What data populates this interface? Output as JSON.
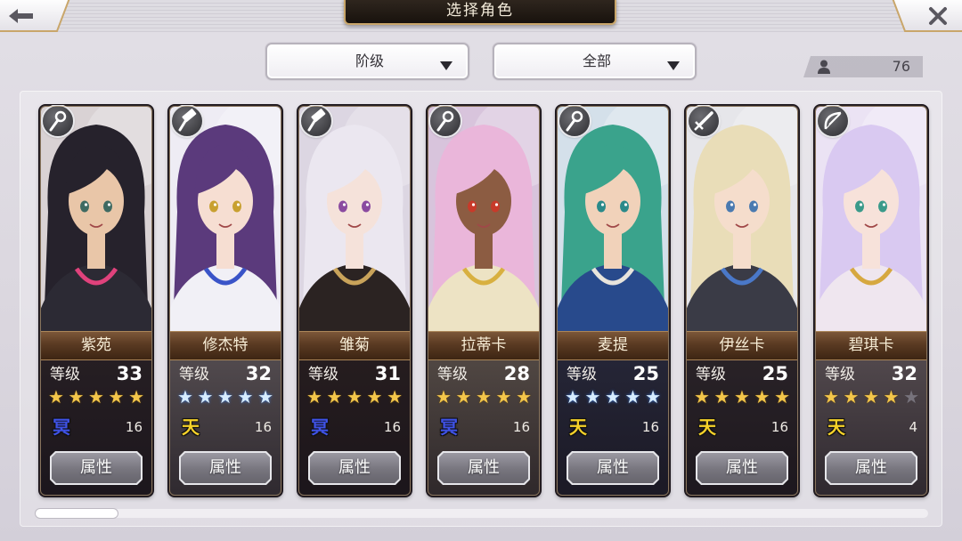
{
  "header": {
    "title": "选择角色",
    "back_icon": "arrow-left-icon",
    "close_icon": "close-icon",
    "accent_color": "#c9a66a"
  },
  "filters": [
    {
      "label": "阶级",
      "icon": "caret-down-icon"
    },
    {
      "label": "全部",
      "icon": "caret-down-icon"
    }
  ],
  "owned_count": {
    "icon": "person-icon",
    "value": "76"
  },
  "level_label": "等级",
  "attribute_button_label": "属性",
  "star_colors": {
    "gold": "#f3c64a",
    "blue": "#d6ecff",
    "empty": "#77737c"
  },
  "characters": [
    {
      "name": "紫苑",
      "level": "33",
      "stars": 5,
      "max_stars": 5,
      "star_tone": "gold",
      "element": "冥",
      "element_color": "#3f52e6",
      "element_value": "16",
      "class_icon": "staff-icon",
      "portrait": {
        "bg": "#d9d2d4",
        "hair": "#26222c",
        "skin": "#e9c6a8",
        "outfit": "#2c2a34",
        "accent": "#e0427c",
        "eye": "#3f6a62"
      }
    },
    {
      "name": "修杰特",
      "level": "32",
      "stars": 5,
      "max_stars": 5,
      "star_tone": "blue",
      "element": "天",
      "element_color": "#f5d12a",
      "element_value": "16",
      "class_icon": "hammer-icon",
      "portrait": {
        "bg": "#eeecf4",
        "hair": "#5b3a7c",
        "skin": "#f6ded2",
        "outfit": "#f1f0f6",
        "accent": "#3a54c8",
        "eye": "#c8a030"
      }
    },
    {
      "name": "雏菊",
      "level": "31",
      "stars": 5,
      "max_stars": 5,
      "star_tone": "gold",
      "element": "冥",
      "element_color": "#3f52e6",
      "element_value": "16",
      "class_icon": "hammer-icon",
      "portrait": {
        "bg": "#dcd6e2",
        "hair": "#ebe7f0",
        "skin": "#f5e2da",
        "outfit": "#2b2322",
        "accent": "#c9a35a",
        "eye": "#8a4aa0"
      }
    },
    {
      "name": "拉蒂卡",
      "level": "28",
      "stars": 5,
      "max_stars": 5,
      "star_tone": "gold",
      "element": "冥",
      "element_color": "#3f52e6",
      "element_value": "16",
      "class_icon": "staff-icon",
      "portrait": {
        "bg": "#d8c4dc",
        "hair": "#eab6da",
        "skin": "#8c5c42",
        "outfit": "#ede3c4",
        "accent": "#d8b040",
        "eye": "#c83a2a"
      }
    },
    {
      "name": "麦提",
      "level": "25",
      "stars": 5,
      "max_stars": 5,
      "star_tone": "blue",
      "element": "天",
      "element_color": "#f5d12a",
      "element_value": "16",
      "class_icon": "staff-icon",
      "portrait": {
        "bg": "#d4e0ea",
        "hair": "#3aa38c",
        "skin": "#f1d2ba",
        "outfit": "#284a8c",
        "accent": "#e8e4dc",
        "eye": "#2a8a8a"
      }
    },
    {
      "name": "伊丝卡",
      "level": "25",
      "stars": 5,
      "max_stars": 5,
      "star_tone": "gold",
      "element": "天",
      "element_color": "#f5d12a",
      "element_value": "16",
      "class_icon": "sword-icon",
      "portrait": {
        "bg": "#e6e6ea",
        "hair": "#e9ddb8",
        "skin": "#f5ddcc",
        "outfit": "#3a3b46",
        "accent": "#4a78c8",
        "eye": "#4a7ab0"
      }
    },
    {
      "name": "碧琪卡",
      "level": "32",
      "stars": 4,
      "max_stars": 5,
      "star_tone": "gold",
      "element": "天",
      "element_color": "#f5d12a",
      "element_value": "4",
      "class_icon": "bow-icon",
      "portrait": {
        "bg": "#ebe3f4",
        "hair": "#d9c9f1",
        "skin": "#f7e2da",
        "outfit": "#efe6ef",
        "accent": "#d6a840",
        "eye": "#3a9a8a"
      }
    }
  ],
  "scroll_position": 0
}
